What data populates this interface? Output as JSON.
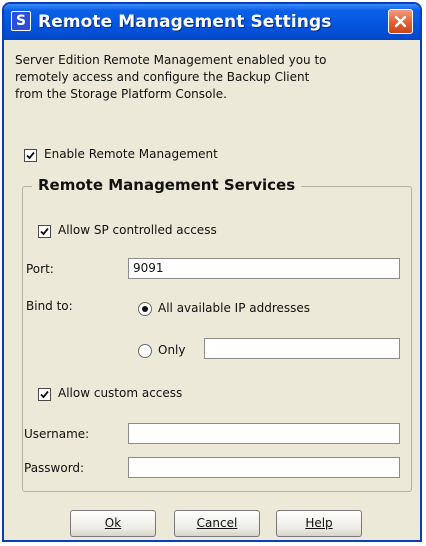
{
  "window": {
    "title": "Remote Management Settings",
    "app_icon_letter": "S",
    "titlebar_color": "#0456e0",
    "close_color": "#e35a2d"
  },
  "description": [
    "Server Edition Remote Management enabled you to",
    "remotely access and configure the Backup Client",
    "from the Storage Platform Console."
  ],
  "enable_remote": {
    "label": "Enable Remote Management",
    "checked": true
  },
  "services": {
    "legend": "Remote Management Services",
    "allow_sp": {
      "label": "Allow SP controlled access",
      "checked": true
    },
    "port": {
      "label": "Port:",
      "value": "9091"
    },
    "bind": {
      "label": "Bind to:",
      "option_all": "All available IP addresses",
      "option_only": "Only",
      "selected": "all",
      "only_value": ""
    },
    "allow_custom": {
      "label": "Allow custom access",
      "checked": true
    },
    "username": {
      "label": "Username:",
      "value": ""
    },
    "password": {
      "label": "Password:",
      "value": ""
    }
  },
  "buttons": {
    "ok": "Ok",
    "cancel": "Cancel",
    "help": "Help"
  }
}
